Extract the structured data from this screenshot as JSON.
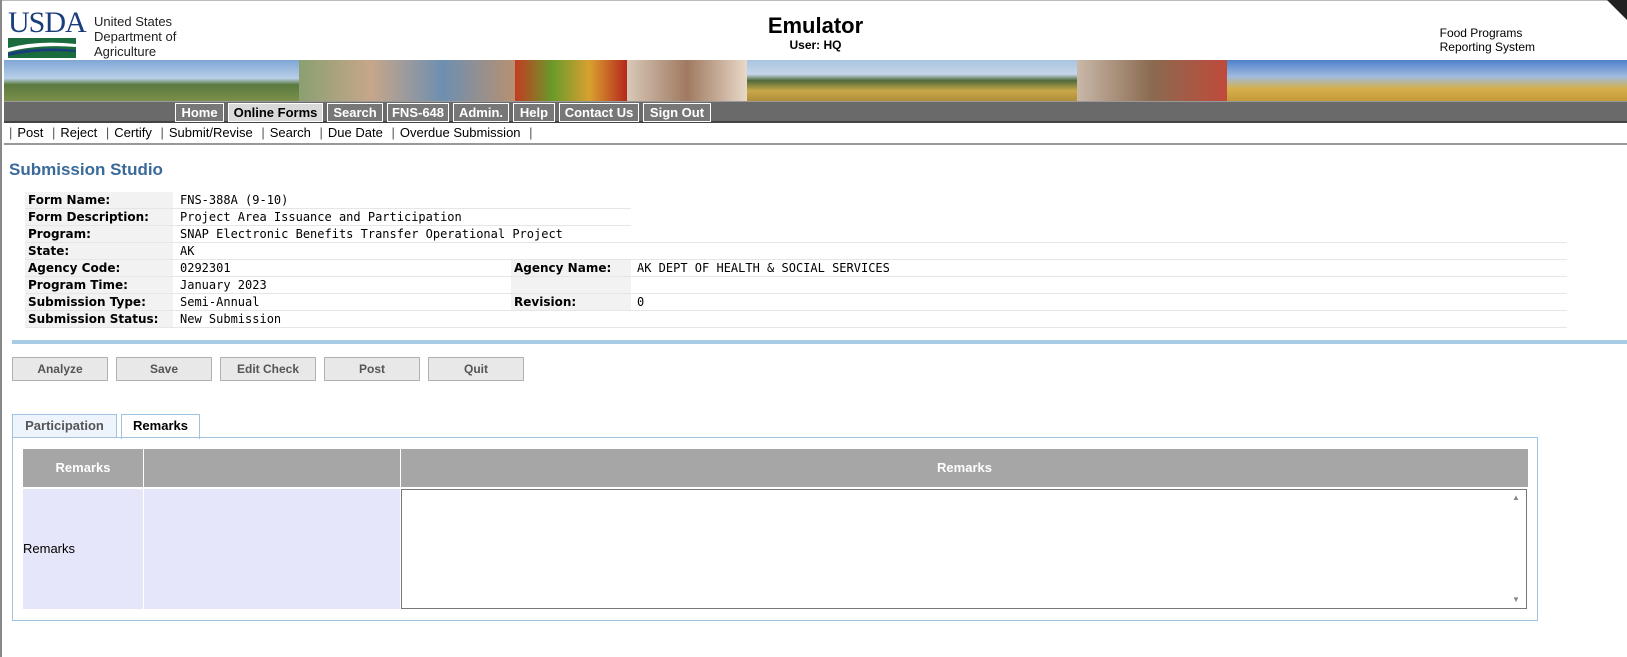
{
  "header": {
    "logo_text": "USDA",
    "department_lines": [
      "United States",
      "Department of",
      "Agriculture"
    ],
    "app_title": "Emulator",
    "user_label": "User: HQ",
    "system_lines": [
      "Food Programs",
      "Reporting System"
    ]
  },
  "nav": {
    "tabs": [
      "Home",
      "Online Forms",
      "Search",
      "FNS-648",
      "Admin.",
      "Help",
      "Contact Us",
      "Sign Out"
    ],
    "active": "Online Forms"
  },
  "subnav": {
    "links": [
      "Post",
      "Reject",
      "Certify",
      "Submit/Revise",
      "Search",
      "Due Date",
      "Overdue Submission"
    ]
  },
  "page_title": "Submission Studio",
  "info": {
    "form_name_label": "Form Name:",
    "form_name": "FNS-388A (9-10)",
    "form_desc_label": "Form Description:",
    "form_desc": "Project Area Issuance and Participation",
    "program_label": "Program:",
    "program": "SNAP Electronic Benefits Transfer Operational Project",
    "state_label": "State:",
    "state": "AK",
    "agency_code_label": "Agency Code:",
    "agency_code": "0292301",
    "agency_name_label": "Agency Name:",
    "agency_name": "AK DEPT OF HEALTH & SOCIAL SERVICES",
    "program_time_label": "Program Time:",
    "program_time": "January 2023",
    "submission_type_label": "Submission Type:",
    "submission_type": "Semi-Annual",
    "revision_label": "Revision:",
    "revision": "0",
    "submission_status_label": "Submission Status:",
    "submission_status": "New Submission"
  },
  "actions": {
    "analyze": "Analyze",
    "save": "Save",
    "edit_check": "Edit Check",
    "post": "Post",
    "quit": "Quit"
  },
  "tabs": {
    "participation": "Participation",
    "remarks": "Remarks"
  },
  "remarks_table": {
    "col1_header": "Remarks",
    "col2_header": "",
    "col3_header": "Remarks",
    "row_label": "Remarks",
    "textarea_value": ""
  },
  "colors": {
    "nav_bg": "#6a6a6a",
    "title_blue": "#3a6a9a",
    "divider": "#a8cce6",
    "table_header": "#a6a6a6",
    "row_bg": "#e6e6fa"
  }
}
